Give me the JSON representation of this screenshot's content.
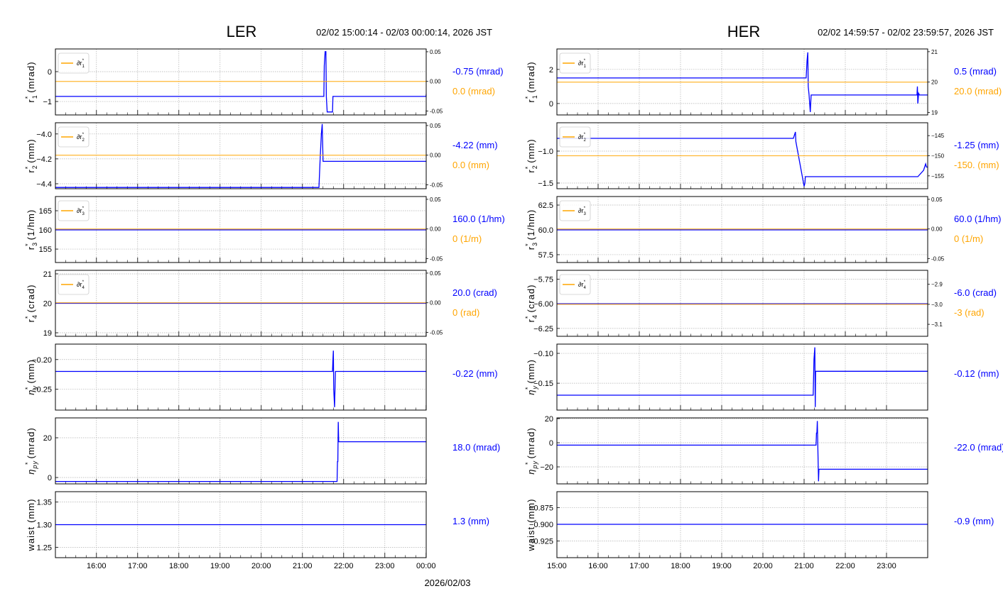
{
  "chart_data": [
    {
      "type": "line",
      "title": "LER",
      "time_range": "02/02 15:00:14 - 02/03 00:00:14, 2026 JST",
      "xlabel": "2026/02/03",
      "xlim": [
        15.004,
        24.004
      ],
      "xticks": [
        16,
        17,
        18,
        19,
        20,
        21,
        22,
        23,
        24
      ],
      "xtick_labels": [
        "16:00",
        "17:00",
        "18:00",
        "19:00",
        "20:00",
        "21:00",
        "22:00",
        "23:00",
        "00:00"
      ],
      "panels": [
        {
          "ylabel": {
            "sym": "r",
            "sub": "1",
            "sup": "*",
            "unit": "(mrad)",
            "italic": false
          },
          "ylim": [
            -1.45,
            0.76
          ],
          "yticks": [
            0,
            -1
          ],
          "ytick_labels": [
            "0",
            "−1"
          ],
          "right": {
            "ylim": [
              -0.0565,
              0.0547
            ],
            "ticks": [
              0.05,
              0,
              -0.05
            ],
            "labels": [
              "0.05",
              "0.00",
              "-0.05"
            ]
          },
          "legend": {
            "sym": "∂r",
            "sub": "1",
            "sup": "*"
          },
          "orange": 0,
          "blue": [
            [
              15.0,
              -0.83
            ],
            [
              21.52,
              -0.83
            ],
            [
              21.53,
              0.2
            ],
            [
              21.55,
              0.67
            ],
            [
              21.57,
              0.67
            ],
            [
              21.58,
              -0.83
            ],
            [
              21.6,
              -1.35
            ],
            [
              21.73,
              -1.35
            ],
            [
              21.74,
              -0.83
            ],
            [
              24.0,
              -0.83
            ],
            [
              24.004,
              -0.75
            ]
          ],
          "readout_blue": "-0.75 (mrad)",
          "readout_orange": "0.0 (mrad)"
        },
        {
          "ylabel": {
            "sym": "r",
            "sub": "2",
            "sup": "*",
            "unit": "(mm)",
            "italic": false
          },
          "ylim": [
            -4.44,
            -3.91
          ],
          "yticks": [
            -4.0,
            -4.2,
            -4.4
          ],
          "ytick_labels": [
            "−4.0",
            "−4.2",
            "−4.4"
          ],
          "right": {
            "ylim": [
              -0.0565,
              0.0547
            ],
            "ticks": [
              0.05,
              0,
              -0.05
            ],
            "labels": [
              "0.05",
              "0.00",
              "-0.05"
            ]
          },
          "legend": {
            "sym": "∂r",
            "sub": "2",
            "sup": "*"
          },
          "orange": 0,
          "blue": [
            [
              15.0,
              -4.43
            ],
            [
              21.4,
              -4.43
            ],
            [
              21.43,
              -4.2
            ],
            [
              21.46,
              -4.0
            ],
            [
              21.48,
              -3.92
            ],
            [
              21.5,
              -4.22
            ],
            [
              24.004,
              -4.22
            ]
          ],
          "readout_blue": "-4.22 (mm)",
          "readout_orange": "0.0 (mm)"
        },
        {
          "ylabel": {
            "sym": "r",
            "sub": "3",
            "sup": "*",
            "unit": "(1/hm)",
            "italic": false
          },
          "ylim": [
            151.5,
            168.7
          ],
          "yticks": [
            165,
            160,
            155
          ],
          "ytick_labels": [
            "165",
            "160",
            "155"
          ],
          "right": {
            "ylim": [
              -0.0565,
              0.0547
            ],
            "ticks": [
              0.05,
              0,
              -0.05
            ],
            "labels": [
              "0.05",
              "0.00",
              "-0.05"
            ]
          },
          "legend": {
            "sym": "∂r",
            "sub": "3",
            "sup": "*"
          },
          "orange": 0,
          "blue": [
            [
              15.0,
              160
            ],
            [
              24.004,
              160
            ]
          ],
          "readout_blue": "160.0 (1/hm)",
          "readout_orange": "0 (1/m)"
        },
        {
          "ylabel": {
            "sym": "r",
            "sub": "4",
            "sup": "*",
            "unit": "(crad)",
            "italic": false
          },
          "ylim": [
            18.88,
            21.12
          ],
          "yticks": [
            21,
            20,
            19
          ],
          "ytick_labels": [
            "21",
            "20",
            "19"
          ],
          "right": {
            "ylim": [
              -0.0565,
              0.0547
            ],
            "ticks": [
              0.05,
              0,
              -0.05
            ],
            "labels": [
              "0.05",
              "0.00",
              "-0.05"
            ]
          },
          "legend": {
            "sym": "∂r",
            "sub": "4",
            "sup": "*"
          },
          "orange": 0,
          "blue": [
            [
              15.0,
              20
            ],
            [
              24.004,
              20
            ]
          ],
          "readout_blue": "20.0 (crad)",
          "readout_orange": "0 (rad)"
        },
        {
          "ylabel": {
            "sym": "η",
            "sub": "y",
            "sup": "*",
            "unit": "(mm)",
            "italic": true
          },
          "ylim": [
            -0.285,
            -0.174
          ],
          "yticks": [
            -0.2,
            -0.25
          ],
          "ytick_labels": [
            "−0.20",
            "−0.25"
          ],
          "blue": [
            [
              15.0,
              -0.22
            ],
            [
              21.73,
              -0.22
            ],
            [
              21.74,
              -0.2
            ],
            [
              21.75,
              -0.185
            ],
            [
              21.76,
              -0.25
            ],
            [
              21.78,
              -0.28
            ],
            [
              21.8,
              -0.22
            ],
            [
              24.004,
              -0.22
            ]
          ],
          "readout_blue": "-0.22 (mm)"
        },
        {
          "ylabel": {
            "sym": "η",
            "sub": "py",
            "sup": "*",
            "unit": "(mrad)",
            "italic": true
          },
          "ylim": [
            -3.2,
            30
          ],
          "yticks": [
            20,
            0
          ],
          "ytick_labels": [
            "20",
            "0"
          ],
          "blue": [
            [
              15.0,
              -2
            ],
            [
              21.84,
              -2
            ],
            [
              21.85,
              8
            ],
            [
              21.86,
              8
            ],
            [
              21.87,
              28
            ],
            [
              21.88,
              18
            ],
            [
              24.004,
              18
            ]
          ],
          "readout_blue": "18.0 (mrad)"
        },
        {
          "ylabel": {
            "sym": "waist",
            "sub": "",
            "sup": "",
            "unit": "(mm)",
            "italic": false
          },
          "ylim": [
            1.227,
            1.373
          ],
          "yticks": [
            1.35,
            1.3,
            1.25
          ],
          "ytick_labels": [
            "1.35",
            "1.30",
            "1.25"
          ],
          "blue": [
            [
              15.0,
              1.3
            ],
            [
              24.004,
              1.3
            ]
          ],
          "readout_blue": "1.3 (mm)"
        }
      ]
    },
    {
      "type": "line",
      "title": "HER",
      "time_range": "02/02 14:59:57 - 02/02 23:59:57, 2026 JST",
      "xlabel": "",
      "xlim": [
        15.0,
        24.0
      ],
      "xticks": [
        15,
        16,
        17,
        18,
        19,
        20,
        21,
        22,
        23
      ],
      "xtick_labels": [
        "15:00",
        "16:00",
        "17:00",
        "18:00",
        "19:00",
        "20:00",
        "21:00",
        "22:00",
        "23:00"
      ],
      "panels": [
        {
          "ylabel": {
            "sym": "r",
            "sub": "1",
            "sup": "*",
            "unit": "(mrad)",
            "italic": false
          },
          "ylim": [
            -0.67,
            3.2
          ],
          "yticks": [
            2,
            0
          ],
          "ytick_labels": [
            "2",
            "0"
          ],
          "right": {
            "ylim": [
              18.92,
              21.09
            ],
            "ticks": [
              21,
              20,
              19
            ],
            "labels": [
              "21",
              "20",
              "19"
            ]
          },
          "legend": {
            "sym": "∂r",
            "sub": "1",
            "sup": "*"
          },
          "orange": 20,
          "blue": [
            [
              15.0,
              1.5
            ],
            [
              21.05,
              1.5
            ],
            [
              21.07,
              2.5
            ],
            [
              21.09,
              3.0
            ],
            [
              21.1,
              1.0
            ],
            [
              21.12,
              0.5
            ],
            [
              21.15,
              -0.5
            ],
            [
              21.17,
              0.5
            ],
            [
              23.74,
              0.5
            ],
            [
              23.75,
              1.0
            ],
            [
              23.76,
              0.0
            ],
            [
              23.78,
              0.6
            ],
            [
              23.8,
              0.5
            ],
            [
              24.0,
              0.5
            ]
          ],
          "readout_blue": "0.5 (mrad)",
          "readout_orange": "20.0 (mrad)"
        },
        {
          "ylabel": {
            "sym": "r",
            "sub": "2",
            "sup": "*",
            "unit": "(mm)",
            "italic": false
          },
          "ylim": [
            -1.589,
            -0.556
          ],
          "yticks": [
            -1.0,
            -1.5
          ],
          "ytick_labels": [
            "−1.0",
            "−1.5"
          ],
          "right": {
            "ylim": [
              -158.2,
              -141.8
            ],
            "ticks": [
              -145,
              -150,
              -155
            ],
            "labels": [
              "−145",
              "−150",
              "−155"
            ]
          },
          "legend": {
            "sym": "∂r",
            "sub": "2",
            "sup": "*"
          },
          "orange": -150,
          "blue": [
            [
              15.0,
              -0.8
            ],
            [
              20.74,
              -0.8
            ],
            [
              20.79,
              -0.7
            ],
            [
              20.8,
              -0.85
            ],
            [
              21.0,
              -1.55
            ],
            [
              21.02,
              -1.5
            ],
            [
              21.03,
              -1.4
            ],
            [
              23.76,
              -1.4
            ],
            [
              23.9,
              -1.3
            ],
            [
              23.95,
              -1.2
            ],
            [
              23.97,
              -1.25
            ],
            [
              24.0,
              -1.25
            ]
          ],
          "readout_blue": "-1.25 (mm)",
          "readout_orange": "-150. (mm)"
        },
        {
          "ylabel": {
            "sym": "r",
            "sub": "3",
            "sup": "*",
            "unit": "(1/hm)",
            "italic": false
          },
          "ylim": [
            56.71,
            63.36
          ],
          "yticks": [
            62.5,
            60.0,
            57.5
          ],
          "ytick_labels": [
            "62.5",
            "60.0",
            "57.5"
          ],
          "right": {
            "ylim": [
              -0.0565,
              0.0547
            ],
            "ticks": [
              0.05,
              0,
              -0.05
            ],
            "labels": [
              "0.05",
              "0.00",
              "-0.05"
            ]
          },
          "legend": {
            "sym": "∂r",
            "sub": "3",
            "sup": "*"
          },
          "orange": 0,
          "blue": [
            [
              15.0,
              60
            ],
            [
              24.0,
              60
            ]
          ],
          "readout_blue": "60.0 (1/hm)",
          "readout_orange": "0 (1/m)"
        },
        {
          "ylabel": {
            "sym": "r",
            "sub": "4",
            "sup": "*",
            "unit": "(crad)",
            "italic": false
          },
          "ylim": [
            -6.33,
            -5.66
          ],
          "yticks": [
            -5.75,
            -6.0,
            -6.25
          ],
          "ytick_labels": [
            "−5.75",
            "−6.00",
            "−6.25"
          ],
          "right": {
            "ylim": [
              -3.16,
              -2.83
            ],
            "ticks": [
              -2.9,
              -3.0,
              -3.1
            ],
            "labels": [
              "−2.9",
              "−3.0",
              "−3.1"
            ]
          },
          "legend": {
            "sym": "∂r",
            "sub": "4",
            "sup": "*"
          },
          "orange": -3.0,
          "blue": [
            [
              15.0,
              -6.0
            ],
            [
              24.0,
              -6.0
            ]
          ],
          "readout_blue": "-6.0 (crad)",
          "readout_orange": "-3 (rad)"
        },
        {
          "ylabel": {
            "sym": "η",
            "sub": "y",
            "sup": "*",
            "unit": "(mm)",
            "italic": true
          },
          "ylim": [
            -0.195,
            -0.0845
          ],
          "yticks": [
            -0.1,
            -0.15
          ],
          "ytick_labels": [
            "−0.10",
            "−0.15"
          ],
          "blue": [
            [
              15.0,
              -0.17
            ],
            [
              21.22,
              -0.17
            ],
            [
              21.24,
              -0.11
            ],
            [
              21.26,
              -0.09
            ],
            [
              21.27,
              -0.19
            ],
            [
              21.28,
              -0.13
            ],
            [
              24.0,
              -0.13
            ]
          ],
          "readout_blue": "-0.12 (mm)"
        },
        {
          "ylabel": {
            "sym": "η",
            "sub": "py",
            "sup": "*",
            "unit": "(mrad)",
            "italic": true
          },
          "ylim": [
            -34.1,
            20.6
          ],
          "yticks": [
            20,
            0,
            -20
          ],
          "ytick_labels": [
            "20",
            "0",
            "−20"
          ],
          "blue": [
            [
              15.0,
              -2
            ],
            [
              21.29,
              -2
            ],
            [
              21.3,
              8
            ],
            [
              21.31,
              8
            ],
            [
              21.32,
              18
            ],
            [
              21.35,
              -32
            ],
            [
              21.36,
              -22
            ],
            [
              24.0,
              -22
            ]
          ],
          "readout_blue": "-22.0 (mrad)"
        },
        {
          "ylabel": {
            "sym": "waist",
            "sub": "",
            "sup": "",
            "unit": "(mm)",
            "italic": false
          },
          "ylim": [
            -0.95,
            -0.851
          ],
          "yticks": [
            -0.875,
            -0.9,
            -0.925
          ],
          "ytick_labels": [
            "−0.875",
            "−0.900",
            "−0.925"
          ],
          "blue": [
            [
              15.0,
              -0.9
            ],
            [
              24.0,
              -0.9
            ]
          ],
          "readout_blue": "-0.9 (mm)"
        }
      ]
    }
  ],
  "colors": {
    "blue": "#0000ff",
    "orange": "#ffa500",
    "grid": "#b0b0b0"
  }
}
